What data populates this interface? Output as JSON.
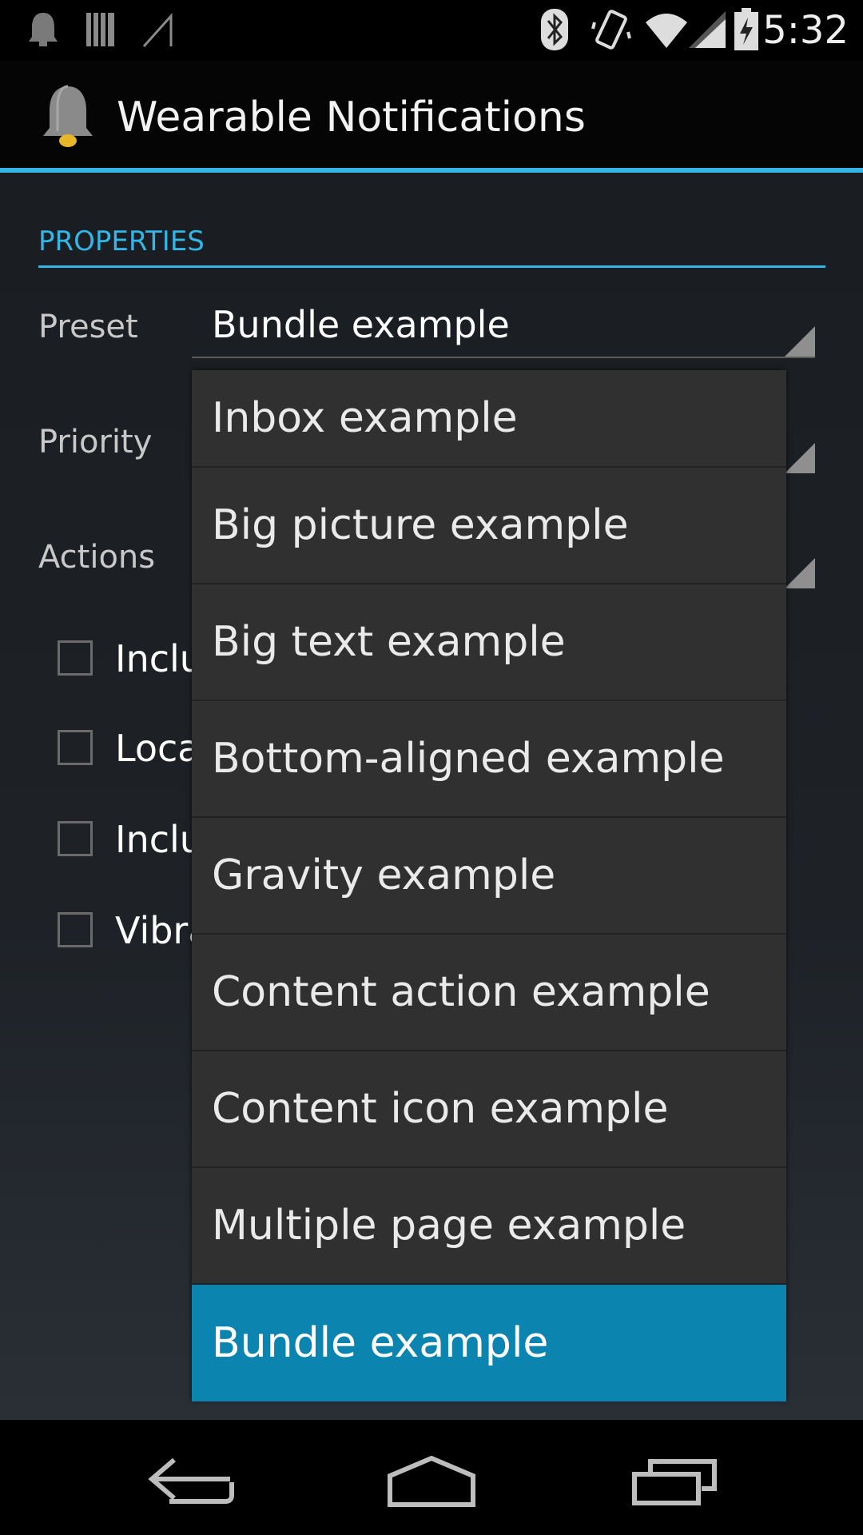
{
  "status_bar": {
    "time": "5:32",
    "icons": [
      "notification-bell-icon",
      "barcode-icon",
      "signal-edge-icon",
      "bluetooth-icon",
      "vibrate-icon",
      "wifi-icon",
      "cell-signal-icon",
      "battery-charging-icon"
    ]
  },
  "action_bar": {
    "icon": "bell-icon",
    "title": "Wearable Notifications"
  },
  "properties": {
    "header": "PROPERTIES",
    "preset_label": "Preset",
    "preset_value": "Bundle example",
    "priority_label": "Priority",
    "actions_label": "Actions",
    "checkboxes": [
      {
        "label": "Inclu",
        "checked": false
      },
      {
        "label": "Loca",
        "checked": false
      },
      {
        "label": "Inclu",
        "checked": false
      },
      {
        "label": "Vibra",
        "checked": false
      }
    ]
  },
  "dropdown": {
    "items": [
      {
        "label": "Inbox example"
      },
      {
        "label": "Big picture example"
      },
      {
        "label": "Big text example"
      },
      {
        "label": "Bottom-aligned example"
      },
      {
        "label": "Gravity example"
      },
      {
        "label": "Content action example"
      },
      {
        "label": "Content icon example"
      },
      {
        "label": "Multiple page example"
      },
      {
        "label": "Bundle example"
      }
    ],
    "selected_index": 8
  },
  "nav_bar": {
    "buttons": [
      "back-icon",
      "home-icon",
      "recent-apps-icon"
    ]
  },
  "colors": {
    "accent": "#33b5e5",
    "selected": "#0c84b0"
  }
}
